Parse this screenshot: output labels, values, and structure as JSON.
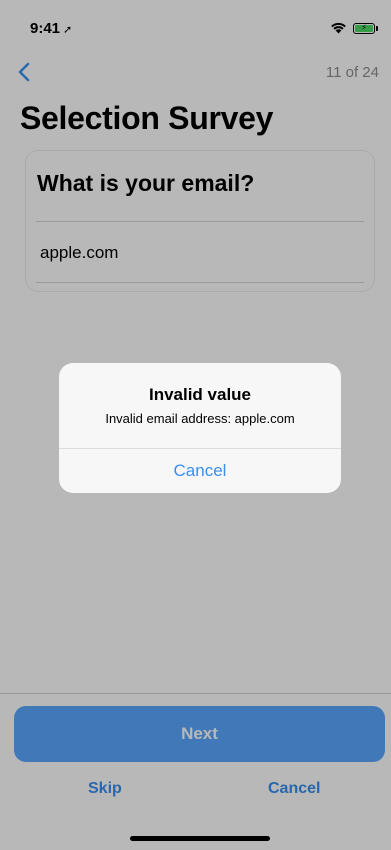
{
  "status_bar": {
    "time": "9:41",
    "location_glyph": "➚",
    "icons": [
      "location-arrow-icon",
      "wifi-icon",
      "battery-charging-icon"
    ]
  },
  "nav": {
    "back_icon": "chevron-left-icon",
    "step_counter": "11 of 24"
  },
  "page": {
    "title": "Selection Survey"
  },
  "question_card": {
    "question": "What is your email?",
    "answer_value": "apple.com"
  },
  "footer": {
    "next_label": "Next",
    "skip_label": "Skip",
    "cancel_label": "Cancel"
  },
  "alert": {
    "title": "Invalid value",
    "message": "Invalid email address: apple.com",
    "cancel_label": "Cancel"
  },
  "colors": {
    "accent": "#3a8ff0",
    "next_button": "#5aa8ff",
    "muted_text": "#8e8e93",
    "battery_charge": "#4cd964"
  }
}
